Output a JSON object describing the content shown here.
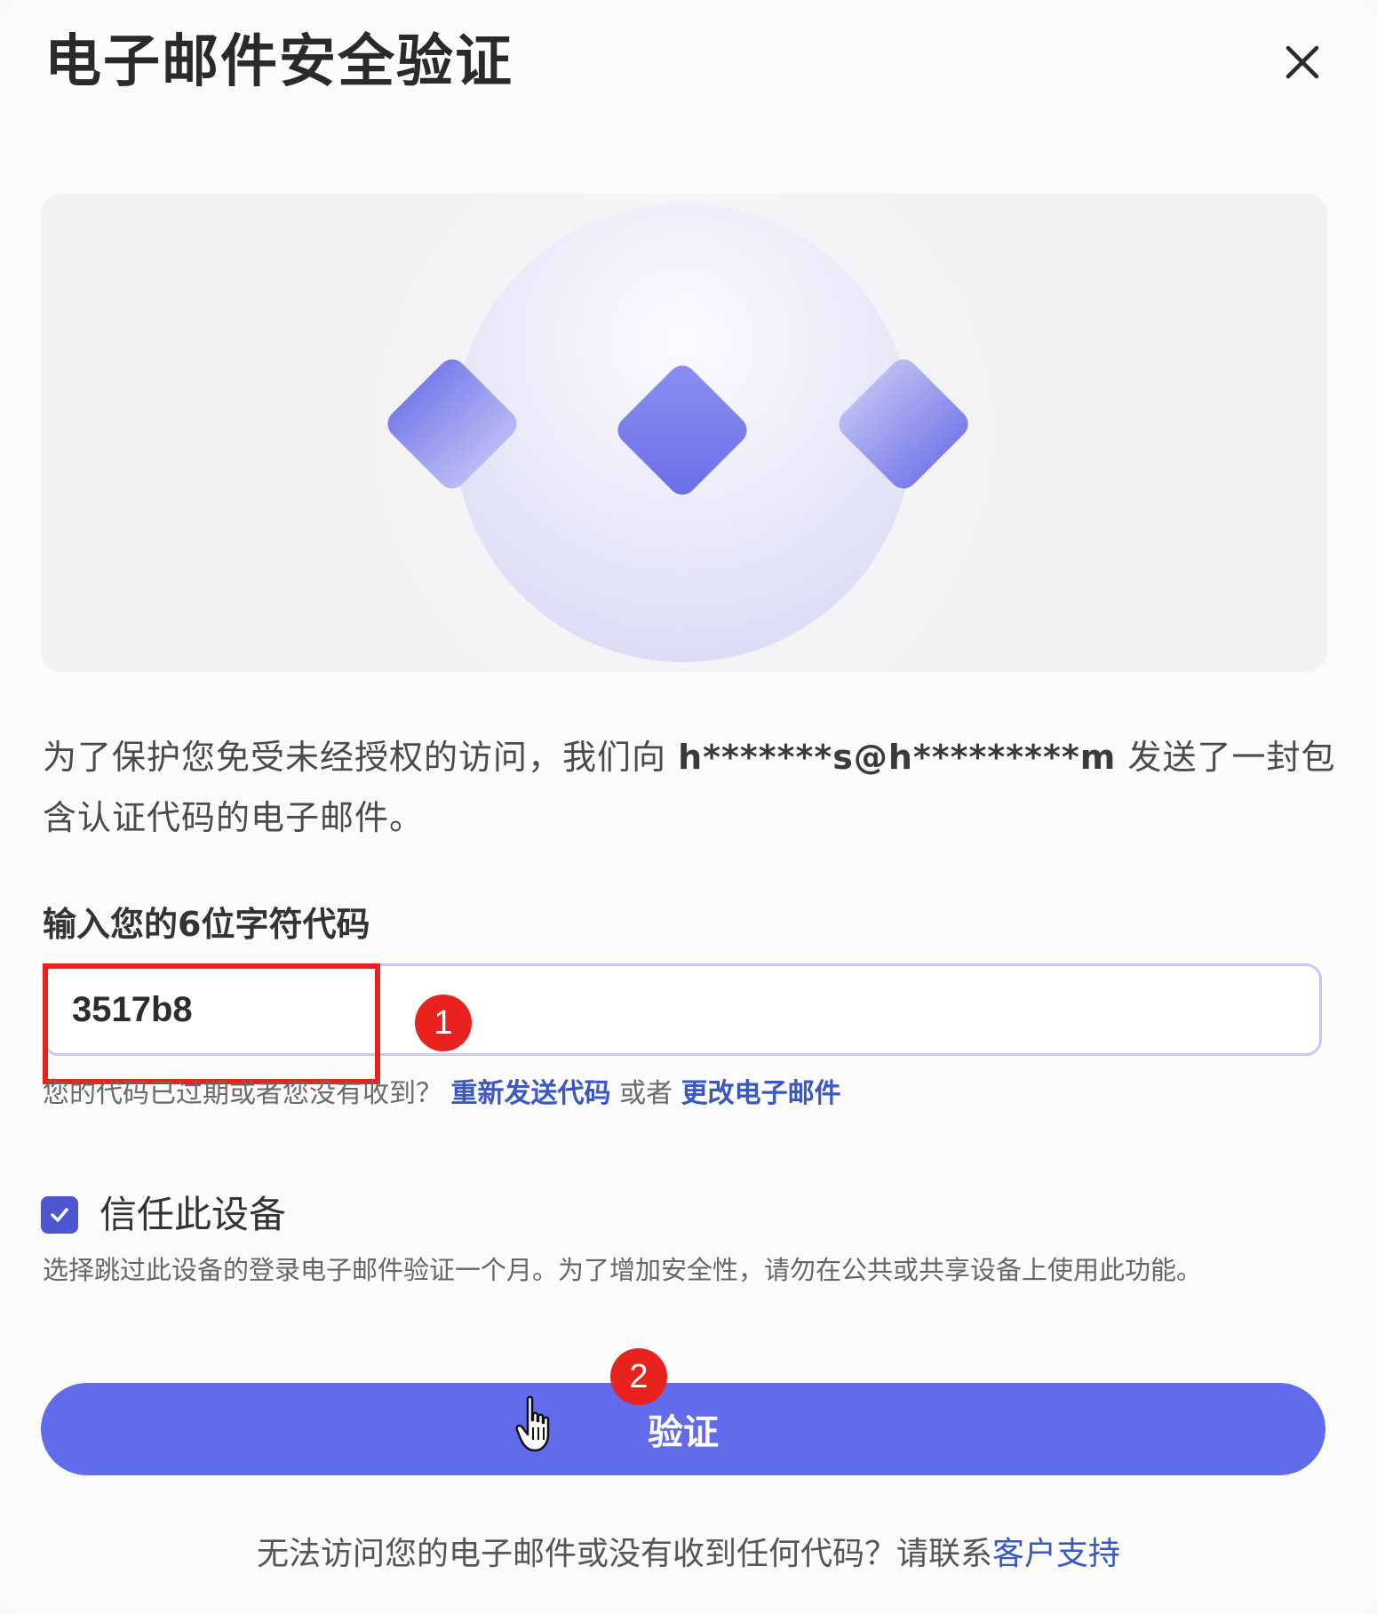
{
  "dialog": {
    "title": "电子邮件安全验证",
    "close_icon": "close-icon"
  },
  "description": {
    "part1": "为了保护您免受未经授权的访问，我们向 ",
    "email": "h*******s@h*********m",
    "part2": " 发送了一封包含认证代码的电子邮件。"
  },
  "code": {
    "label": "输入您的6位字符代码",
    "value": "3517b8"
  },
  "help": {
    "prefix": "您的代码已过期或者您没有收到？",
    "resend_link": "重新发送代码",
    "or": " 或者 ",
    "change_email_link": "更改电子邮件"
  },
  "trust": {
    "checked": true,
    "label": "信任此设备",
    "description": "选择跳过此设备的登录电子邮件验证一个月。为了增加安全性，请勿在公共或共享设备上使用此功能。"
  },
  "verify_button": {
    "label": "验证"
  },
  "footer": {
    "text": "无法访问您的电子邮件或没有收到任何代码？请联系",
    "link": "客户支持"
  },
  "annotations": {
    "marker_1": "1",
    "marker_2": "2"
  },
  "colors": {
    "accent": "#636bed",
    "link": "#3b57c4",
    "annotation_red": "#e8231d",
    "diamond": "#7478ec"
  }
}
